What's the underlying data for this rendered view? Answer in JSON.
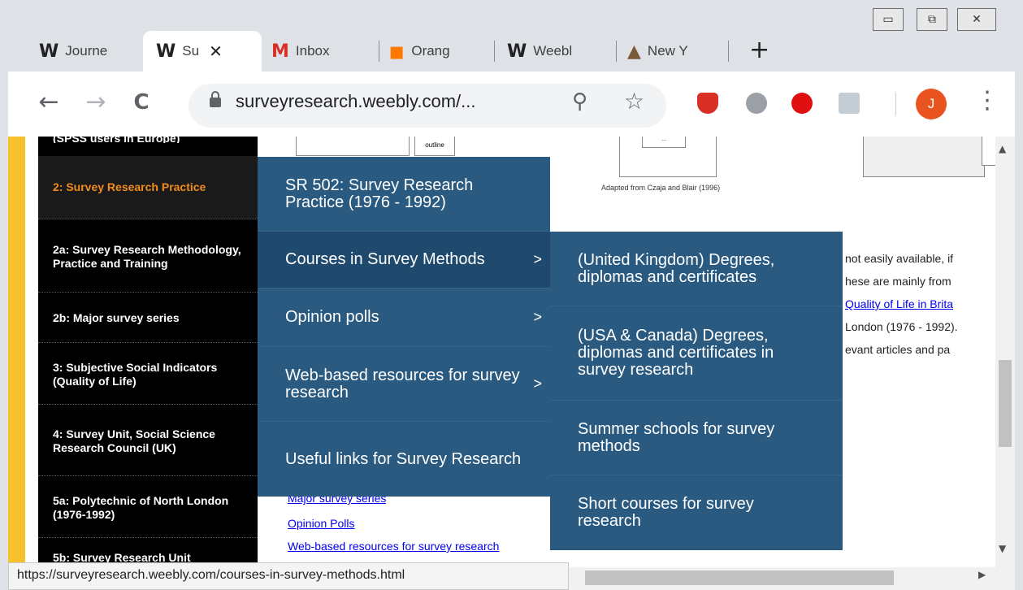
{
  "window": {
    "minimize": "▭",
    "restore": "⧉",
    "close": "✕"
  },
  "tabs": [
    {
      "icon": "W",
      "label": "Journe",
      "active": false
    },
    {
      "icon": "W",
      "label": "Su",
      "active": true,
      "close": "✕"
    },
    {
      "icon": "M",
      "label": "Inbox",
      "active": false
    },
    {
      "icon": "▪",
      "label": "Orang",
      "active": false
    },
    {
      "icon": "W",
      "label": "Weebl",
      "active": false
    },
    {
      "icon": "▲",
      "label": "New Y",
      "active": false
    }
  ],
  "new_tab": "+",
  "nav": {
    "back": "←",
    "forward": "→",
    "reload": "C"
  },
  "omnibox": {
    "url": "surveyresearch.weebly.com/...",
    "zoom_icon": "⚲",
    "star_icon": "☆"
  },
  "avatar": "J",
  "menu_dots": "⋮",
  "sidebar": {
    "top_fragment": "(SPSS users in Europe)",
    "items": [
      {
        "label": "2: Survey Research Practice"
      },
      {
        "label": "2a: Survey Research Methodology, Practice and Training"
      },
      {
        "label": "2b: Major survey series"
      },
      {
        "label": "3: Subjective Social Indicators (Quality of Life)"
      },
      {
        "label": "4: Survey Unit, Social Science Research Council (UK)"
      },
      {
        "label": "5a: Polytechnic of North London (1976-1992)"
      },
      {
        "label": "5b: Survey Research Unit"
      }
    ]
  },
  "content": {
    "thumb_caption": "outline",
    "figure_caption": "Adapted from Czaja and Blair (1996)",
    "thumb_text": "...",
    "para": [
      "not easily available, if",
      "hese are mainly from",
      "Quality of Life in Brita",
      "London (1976 - 1992).",
      "evant articles and pa"
    ],
    "links": [
      "Major survey series",
      "Opinion Polls",
      "Web-based resources for survey research"
    ]
  },
  "menu1": [
    {
      "label": "SR 502: Survey Research Practice (1976 - 1992)",
      "chev": ""
    },
    {
      "label": "Courses in Survey Methods",
      "chev": ">"
    },
    {
      "label": "Opinion polls",
      "chev": ">"
    },
    {
      "label": "Web-based resources for survey research",
      "chev": ">"
    },
    {
      "label": "Useful links for Survey Research",
      "chev": ""
    }
  ],
  "menu2": [
    {
      "label": "(United Kingdom) Degrees, diplomas and certificates"
    },
    {
      "label": "(USA & Canada) Degrees, diplomas and certificates in survey research"
    },
    {
      "label": "Summer schools for survey methods"
    },
    {
      "label": "Short courses for survey research"
    }
  ],
  "status_url": "https://surveyresearch.weebly.com/courses-in-survey-methods.html",
  "scroll": {
    "up": "▲",
    "down": "▼",
    "right": "▶"
  }
}
